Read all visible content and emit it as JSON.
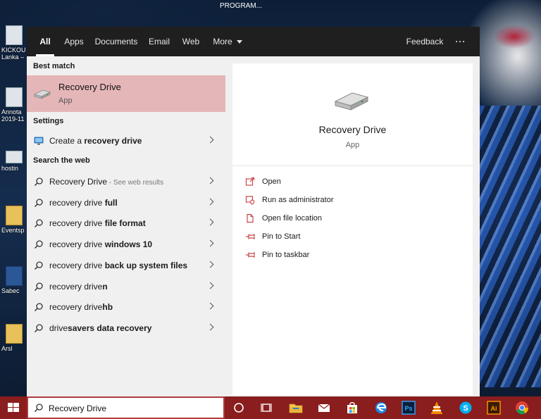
{
  "desktop": {
    "top_label": "PROGRAM...",
    "icons": [
      {
        "label": "KICKOU Lanka –",
        "kind": "doc"
      },
      {
        "label": "Annota 2019-11",
        "kind": "doc"
      },
      {
        "label": "hostin",
        "kind": "doc"
      },
      {
        "label": "Eventsp",
        "kind": "folder"
      },
      {
        "label": "Sabec",
        "kind": "word"
      },
      {
        "label": "Arsl",
        "kind": "folder"
      }
    ]
  },
  "tabs": [
    {
      "label": "All",
      "active": true
    },
    {
      "label": "Apps"
    },
    {
      "label": "Documents"
    },
    {
      "label": "Email"
    },
    {
      "label": "Web"
    },
    {
      "label": "More"
    }
  ],
  "feedback_label": "Feedback",
  "overflow_label": "···",
  "results": {
    "best_match_heading": "Best match",
    "best_match": {
      "title": "Recovery Drive",
      "subtitle": "App"
    },
    "settings_heading": "Settings",
    "settings_item": {
      "pre": "Create a ",
      "bold": "recovery drive"
    },
    "web_heading": "Search the web",
    "web_items": [
      {
        "pre": "Recovery Drive",
        "bold": "",
        "hint": " - See web results"
      },
      {
        "pre": "recovery drive ",
        "bold": "full",
        "hint": ""
      },
      {
        "pre": "recovery drive ",
        "bold": "file format",
        "hint": ""
      },
      {
        "pre": "recovery drive ",
        "bold": "windows 10",
        "hint": ""
      },
      {
        "pre": "recovery drive ",
        "bold": "back up system files",
        "hint": ""
      },
      {
        "pre": "recovery drive",
        "bold": "n",
        "hint": ""
      },
      {
        "pre": "recovery drive",
        "bold": "hb",
        "hint": ""
      },
      {
        "pre": "drive",
        "bold": "savers data recovery",
        "hint": ""
      }
    ]
  },
  "preview": {
    "title": "Recovery Drive",
    "subtitle": "App",
    "actions": [
      {
        "label": "Open",
        "icon": "open-icon"
      },
      {
        "label": "Run as administrator",
        "icon": "shield-icon"
      },
      {
        "label": "Open file location",
        "icon": "file-location-icon"
      },
      {
        "label": "Pin to Start",
        "icon": "pin-icon"
      },
      {
        "label": "Pin to taskbar",
        "icon": "pin-icon"
      }
    ]
  },
  "taskbar": {
    "search_value": "Recovery Drive",
    "apps": [
      "cortana-icon",
      "task-view-icon",
      "file-explorer-icon",
      "mail-icon",
      "store-icon",
      "edge-icon",
      "photoshop-icon",
      "vlc-icon",
      "skype-icon",
      "illustrator-icon",
      "chrome-icon"
    ]
  },
  "colors": {
    "accent_red": "#8a1d1d",
    "best_match_bg": "#e5b6b8",
    "tabbar_bg": "#1f1f1f",
    "action_icon_red": "#c8464c"
  }
}
